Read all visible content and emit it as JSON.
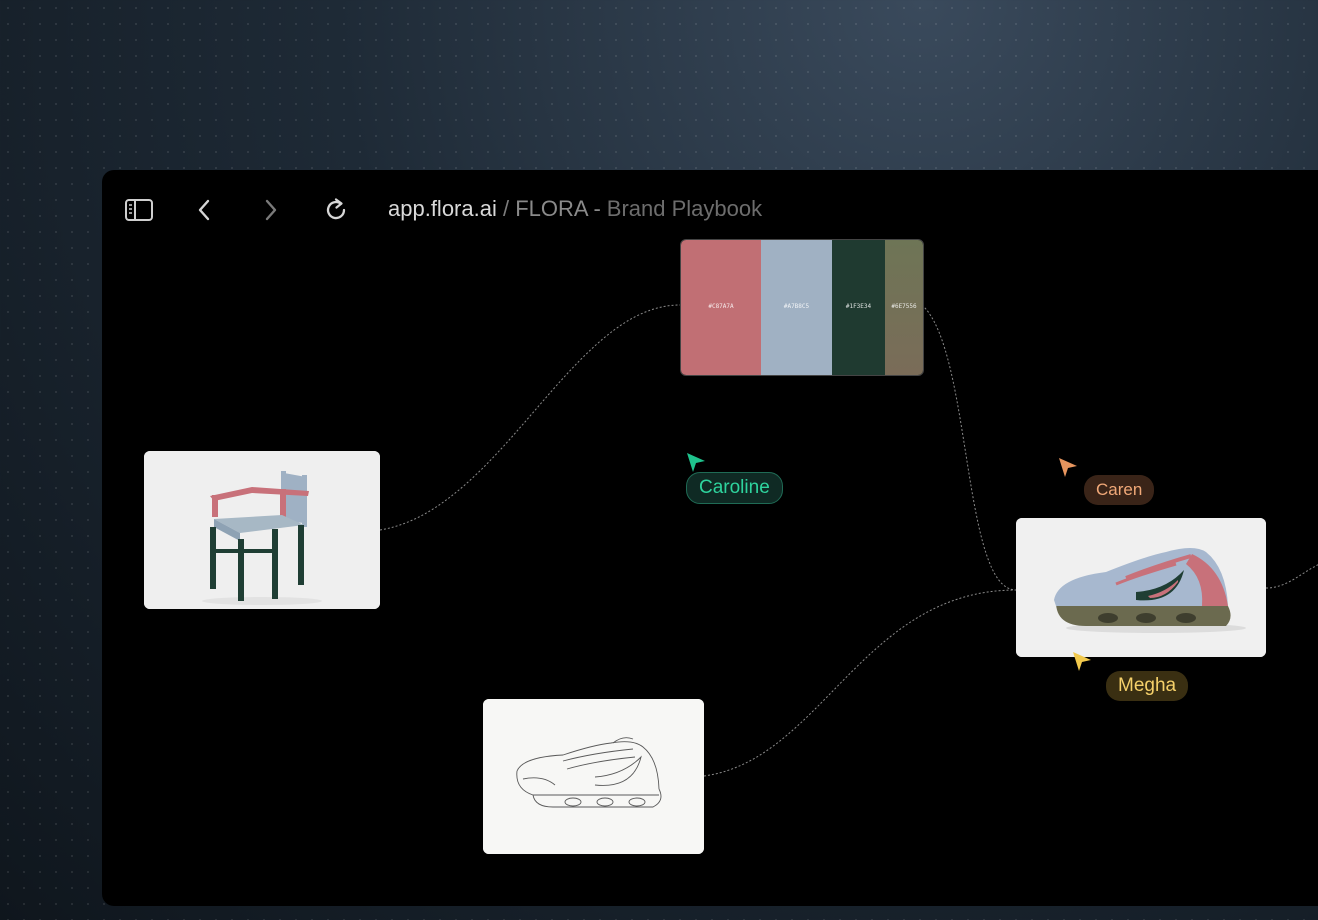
{
  "browser": {
    "host": "app.flora.ai",
    "separator": " / ",
    "project": "FLORA -",
    "page": "Brand Playbook"
  },
  "icons": {
    "sidebar": "sidebar-toggle-icon",
    "back": "chevron-left-icon",
    "forward": "chevron-right-icon",
    "reload": "reload-icon"
  },
  "palette": {
    "swatches": [
      {
        "hex": "#C87A7A",
        "label": "#C87A7A"
      },
      {
        "hex": "#A7B8C5",
        "label": "#A7B8C5"
      },
      {
        "hex": "#1F3E34",
        "label": "#1F3E34"
      },
      {
        "hex": "#6E7556",
        "label": "#6E7556"
      }
    ]
  },
  "collaborators": {
    "caroline": {
      "name": "Caroline",
      "color": "#1fc38d"
    },
    "caren": {
      "name": "Caren",
      "color": "#e7955e"
    },
    "megha": {
      "name": "Megha",
      "color": "#f2c94c"
    }
  }
}
